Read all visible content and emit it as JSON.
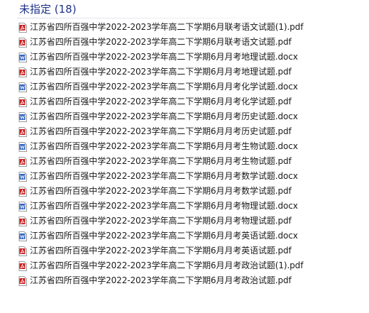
{
  "group": {
    "header": "未指定 (18)",
    "files": [
      {
        "name": "江苏省四所百强中学2022-2023学年高二下学期6月联考语文试题(1).pdf",
        "icon": "pdf-icon"
      },
      {
        "name": "江苏省四所百强中学2022-2023学年高二下学期6月联考语文试题.pdf",
        "icon": "pdf-icon"
      },
      {
        "name": "江苏省四所百强中学2022-2023学年高二下学期6月月考地理试题.docx",
        "icon": "word-icon"
      },
      {
        "name": "江苏省四所百强中学2022-2023学年高二下学期6月月考地理试题.pdf",
        "icon": "pdf-icon"
      },
      {
        "name": "江苏省四所百强中学2022-2023学年高二下学期6月月考化学试题.docx",
        "icon": "word-icon"
      },
      {
        "name": "江苏省四所百强中学2022-2023学年高二下学期6月月考化学试题.pdf",
        "icon": "pdf-icon"
      },
      {
        "name": "江苏省四所百强中学2022-2023学年高二下学期6月月考历史试题.docx",
        "icon": "word-icon"
      },
      {
        "name": "江苏省四所百强中学2022-2023学年高二下学期6月月考历史试题.pdf",
        "icon": "pdf-icon"
      },
      {
        "name": "江苏省四所百强中学2022-2023学年高二下学期6月月考生物试题.docx",
        "icon": "word-icon"
      },
      {
        "name": "江苏省四所百强中学2022-2023学年高二下学期6月月考生物试题.pdf",
        "icon": "pdf-icon"
      },
      {
        "name": "江苏省四所百强中学2022-2023学年高二下学期6月月考数学试题.docx",
        "icon": "word-icon"
      },
      {
        "name": "江苏省四所百强中学2022-2023学年高二下学期6月月考数学试题.pdf",
        "icon": "pdf-icon"
      },
      {
        "name": "江苏省四所百强中学2022-2023学年高二下学期6月月考物理试题.docx",
        "icon": "word-icon"
      },
      {
        "name": "江苏省四所百强中学2022-2023学年高二下学期6月月考物理试题.pdf",
        "icon": "pdf-icon"
      },
      {
        "name": "江苏省四所百强中学2022-2023学年高二下学期6月月考英语试题.docx",
        "icon": "word-icon"
      },
      {
        "name": "江苏省四所百强中学2022-2023学年高二下学期6月月考英语试题.pdf",
        "icon": "pdf-icon"
      },
      {
        "name": "江苏省四所百强中学2022-2023学年高二下学期6月月考政治试题(1).pdf",
        "icon": "pdf-icon"
      },
      {
        "name": "江苏省四所百强中学2022-2023学年高二下学期6月月考政治试题.pdf",
        "icon": "pdf-icon"
      }
    ]
  },
  "colors": {
    "header_text": "#1e3287",
    "pdf_icon": "#cc2020",
    "word_icon": "#2b5fbf",
    "file_text": "#1a1a1a"
  }
}
